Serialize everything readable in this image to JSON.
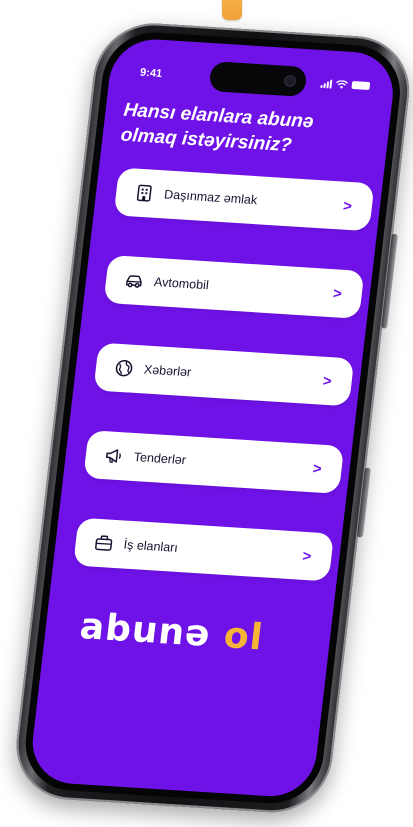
{
  "status_bar": {
    "time": "9:41"
  },
  "header": {
    "title": "Hansı elanlara abunə olmaq istəyirsiniz?"
  },
  "categories": [
    {
      "label": "Daşınmaz əmlak",
      "icon": "building-icon"
    },
    {
      "label": "Avtomobil",
      "icon": "car-icon"
    },
    {
      "label": "Xəbərlər",
      "icon": "globe-icon"
    },
    {
      "label": "Tenderlər",
      "icon": "megaphone-icon"
    },
    {
      "label": "İş elanları",
      "icon": "briefcase-icon"
    }
  ],
  "chevron": ">",
  "brand": {
    "logo_main": "abunə",
    "logo_accent": "ol"
  },
  "colors": {
    "screen_bg": "#6f12e8",
    "card_bg": "#ffffff",
    "accent": "#f6b437"
  }
}
